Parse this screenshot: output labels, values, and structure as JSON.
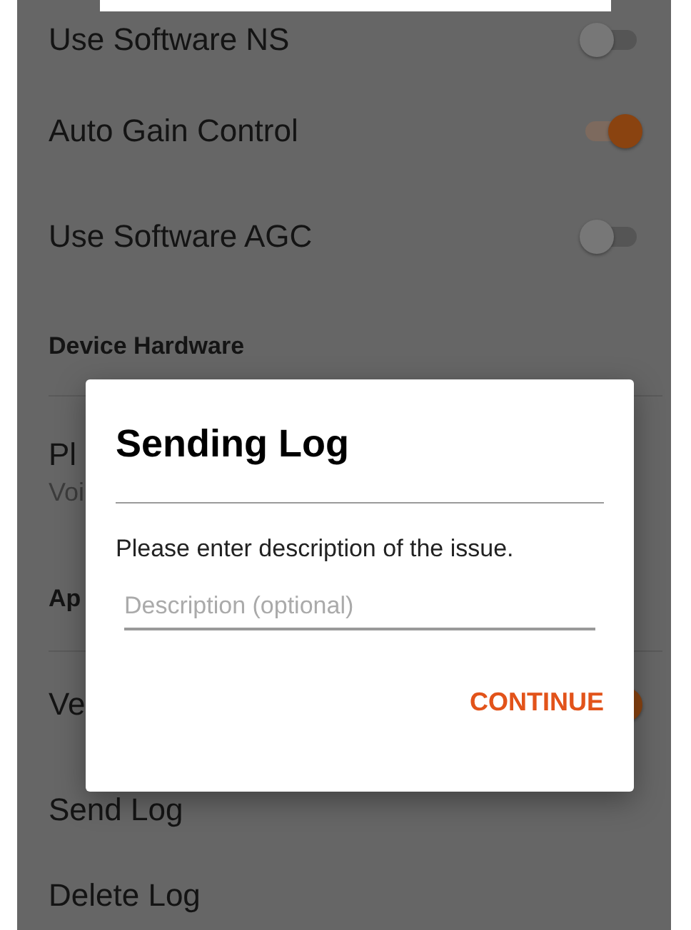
{
  "settings": [
    {
      "kind": "switch",
      "label": "Use Software NS",
      "on": false
    },
    {
      "kind": "switch",
      "label": "Auto Gain Control",
      "on": true
    },
    {
      "kind": "switch",
      "label": "Use Software AGC",
      "on": false
    },
    {
      "kind": "header",
      "label": "Device Hardware"
    },
    {
      "kind": "two_line",
      "label": "Pl",
      "subtitle": "Voi"
    },
    {
      "kind": "header",
      "label": "Ap"
    },
    {
      "kind": "switch",
      "label": "Ve",
      "on": true
    },
    {
      "kind": "plain",
      "label": "Send Log"
    },
    {
      "kind": "plain",
      "label": "Delete Log"
    }
  ],
  "dialog": {
    "title": "Sending Log",
    "message": "Please enter description of the issue.",
    "field": {
      "placeholder": "Description (optional)"
    },
    "buttons": [
      "CONTINUE"
    ]
  }
}
